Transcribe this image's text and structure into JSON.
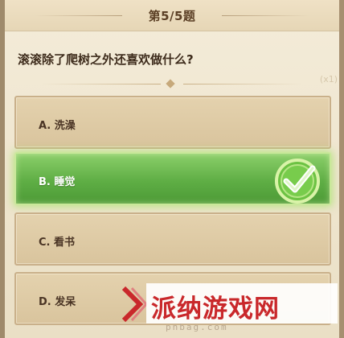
{
  "header": {
    "title": "第5/5题"
  },
  "question": {
    "text": "滚滚除了爬树之外还喜欢做什么?"
  },
  "options": [
    {
      "label": "A. 洗澡",
      "state": "normal"
    },
    {
      "label": "B. 睡觉",
      "state": "correct"
    },
    {
      "label": "C. 看书",
      "state": "normal"
    },
    {
      "label": "D. 发呆",
      "state": "normal"
    }
  ],
  "decor": {
    "right_text": "(x1)"
  },
  "watermark": {
    "title": "派纳游戏网",
    "url": "pnbag.com"
  },
  "colors": {
    "correct_green": "#5fae45",
    "option_tan": "#dcc7a0",
    "check_green": "#7fd44a",
    "watermark_red": "#c9282b"
  },
  "icons": {
    "correct": "checkmark-icon",
    "watermark_logo": "chevron-logo-icon"
  }
}
